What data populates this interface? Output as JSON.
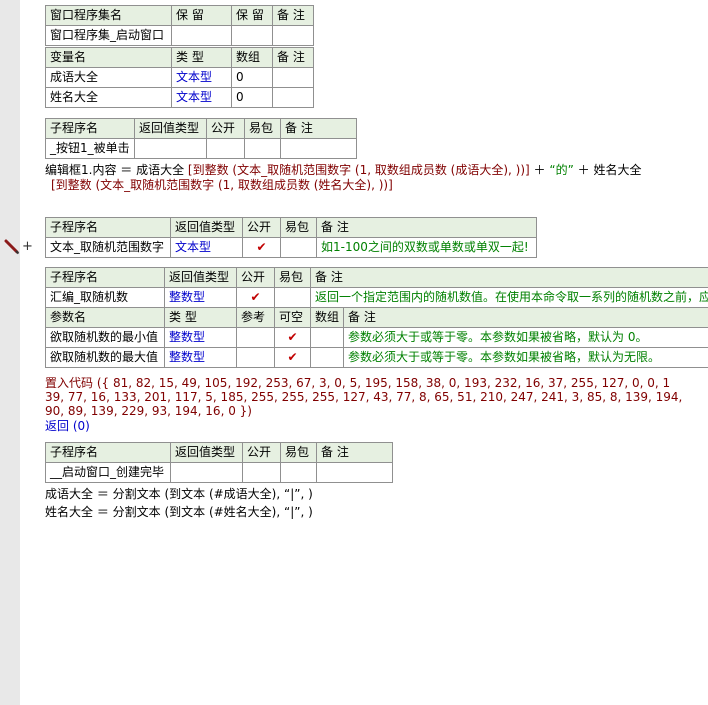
{
  "t1": {
    "h": [
      "窗口程序集名",
      "保 留",
      "保 留",
      "备 注"
    ],
    "r": [
      "窗口程序集_启动窗口",
      "",
      "",
      ""
    ]
  },
  "t2": {
    "h": [
      "变量名",
      "类 型",
      "数组",
      "备 注"
    ],
    "rows": [
      [
        "成语大全",
        "文本型",
        "0",
        ""
      ],
      [
        "姓名大全",
        "文本型",
        "0",
        ""
      ]
    ]
  },
  "t3": {
    "h": [
      "子程序名",
      "返回值类型",
      "公开",
      "易包",
      "备 注"
    ],
    "r": [
      "_按钮1_被单击",
      "",
      "",
      "",
      ""
    ]
  },
  "code1": {
    "a": "编辑框1.内容 ＝ 成语大全",
    "b": "[到整数 (文本_取随机范围数字 (1, 取数组成员数 (成语大全), ))]",
    "c": "＋",
    "d": "“的”",
    "e": "＋ 姓名大全",
    "f": "[到整数 (文本_取随机范围数字 (1, 取数组成员数 (姓名大全), ))]"
  },
  "t4": {
    "h": [
      "子程序名",
      "返回值类型",
      "公开",
      "易包",
      "备 注"
    ],
    "r": [
      "文本_取随机范围数字",
      "文本型",
      "✔",
      "",
      "如1-100之间的双数或单数或单双一起!"
    ]
  },
  "t5": {
    "h": [
      "子程序名",
      "返回值类型",
      "公开",
      "易包",
      "备 注"
    ],
    "r": [
      "汇编_取随机数",
      "整数型",
      "✔",
      "",
      "返回一个指定范围内的随机数值。在使用本命令取一系列的随机数之前，应"
    ],
    "ph": [
      "参数名",
      "类 型",
      "参考",
      "可空",
      "数组",
      "备 注"
    ],
    "params": [
      [
        "欲取随机数的最小值",
        "整数型",
        "",
        "✔",
        "",
        "参数必须大于或等于零。本参数如果被省略，默认为 0。"
      ],
      [
        "欲取随机数的最大值",
        "整数型",
        "",
        "✔",
        "",
        "参数必须大于或等于零。本参数如果被省略，默认为无限。"
      ]
    ]
  },
  "code2": {
    "l1": "置入代码 ({ 81, 82, 15, 49, 105, 192, 253, 67, 3, 0, 5, 195, 158, 38, 0, 193, 232, 16, 37, 255, 127, 0, 0, 1",
    "l2": "39, 77, 16, 133, 201, 117, 5, 185, 255, 255, 255, 127, 43, 77, 8, 65, 51, 210, 247, 241, 3, 85, 8, 139, 194,",
    "l3": " 90, 89, 139, 229, 93, 194, 16, 0 })",
    "l4": "返回 (0)"
  },
  "t6": {
    "h": [
      "子程序名",
      "返回值类型",
      "公开",
      "易包",
      "备 注"
    ],
    "r": [
      "__启动窗口_创建完毕",
      "",
      "",
      "",
      ""
    ]
  },
  "code3": {
    "l1": "成语大全 ＝ 分割文本 (到文本 (#成语大全), “|”, )",
    "l2": "姓名大全 ＝ 分割文本 (到文本 (#姓名大全), “|”, )"
  }
}
